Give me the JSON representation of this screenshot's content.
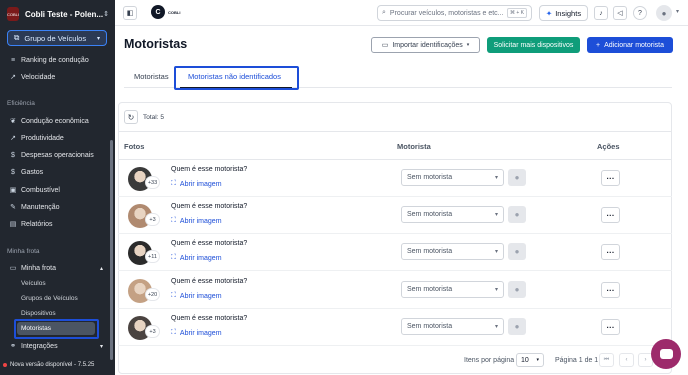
{
  "sidebar": {
    "org_name": "Cobli Teste - Polen...",
    "org_logo_text": "COBLI",
    "group_button": "Grupo de Veículos",
    "items_top": [
      {
        "label": "Ranking de condução",
        "icon": "list-icon"
      },
      {
        "label": "Velocidade",
        "icon": "trend-icon"
      }
    ],
    "section_efficiency": "Eficiência",
    "items_efficiency": [
      {
        "label": "Condução econômica",
        "icon": "leaf-icon"
      },
      {
        "label": "Produtividade",
        "icon": "chart-icon"
      },
      {
        "label": "Despesas operacionais",
        "icon": "dollar-icon"
      },
      {
        "label": "Gastos",
        "icon": "dollar-icon"
      },
      {
        "label": "Combustível",
        "icon": "fuel-icon"
      },
      {
        "label": "Manutenção",
        "icon": "wrench-icon"
      },
      {
        "label": "Relatórios",
        "icon": "report-icon"
      }
    ],
    "section_fleet": "Minha frota",
    "fleet_parent": "Minha frota",
    "fleet_items": [
      "Veículos",
      "Grupos de Veículos",
      "Dispositivos",
      "Motoristas"
    ],
    "integrations": "Integrações",
    "version": "Nova versão disponível - 7.5.25"
  },
  "topbar": {
    "logo_text": "COBLI",
    "search_placeholder": "Procurar veículos, motoristas e etc...",
    "search_shortcut": "⌘ + K",
    "insights": "Insights"
  },
  "main": {
    "title": "Motoristas",
    "import_button": "Importar identificações",
    "request_button": "Solicitar mais dispositivos",
    "add_button": "Adicionar motorista",
    "tabs": [
      "Motoristas",
      "Motoristas não identificados"
    ],
    "total": "Total: 5",
    "columns": [
      "Fotos",
      "Motorista",
      "Ações"
    ],
    "rows": [
      {
        "badge": "+33",
        "question": "Quem é esse motorista?",
        "open": "Abrir imagem",
        "select": "Sem motorista",
        "face": "#3a3a3a"
      },
      {
        "badge": "+3",
        "question": "Quem é esse motorista?",
        "open": "Abrir imagem",
        "select": "Sem motorista",
        "face": "#b08a70"
      },
      {
        "badge": "+11",
        "question": "Quem é esse motorista?",
        "open": "Abrir imagem",
        "select": "Sem motorista",
        "face": "#2b2b2b"
      },
      {
        "badge": "+20",
        "question": "Quem é esse motorista?",
        "open": "Abrir imagem",
        "select": "Sem motorista",
        "face": "#c4a184"
      },
      {
        "badge": "+3",
        "question": "Quem é esse motorista?",
        "open": "Abrir imagem",
        "select": "Sem motorista",
        "face": "#4a4340"
      }
    ],
    "pagination": {
      "label": "Itens por página",
      "per_page": "10",
      "page_info": "Página 1 de 1"
    }
  }
}
